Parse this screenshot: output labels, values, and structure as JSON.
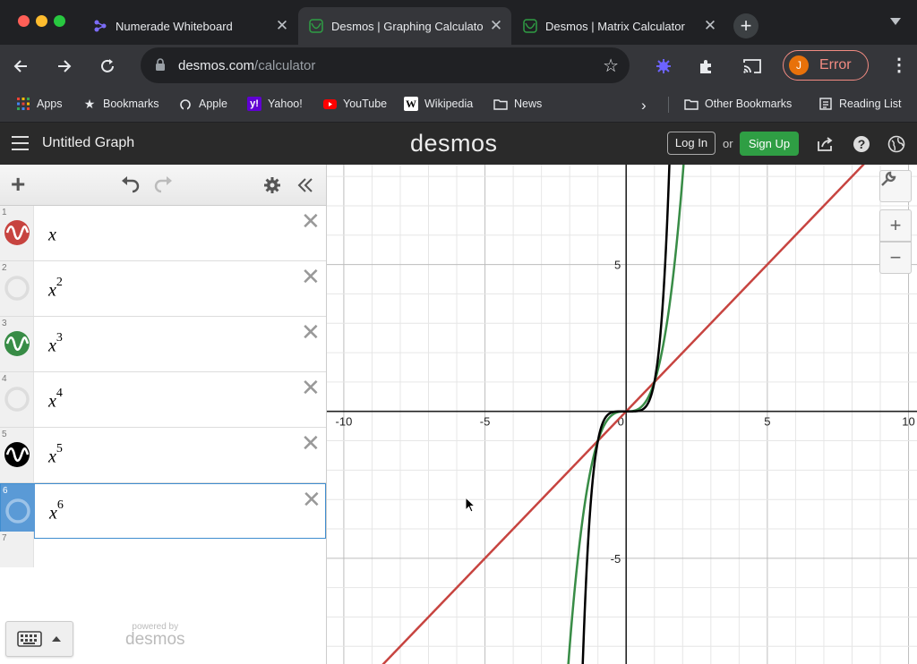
{
  "browser": {
    "tabs": [
      {
        "title": "Numerade Whiteboard",
        "favicon": "numerade-icon"
      },
      {
        "title": "Desmos | Graphing Calculato",
        "favicon": "desmos-icon",
        "active": true
      },
      {
        "title": "Desmos | Matrix Calculator",
        "favicon": "desmos-icon"
      }
    ],
    "close_glyph": "✕",
    "new_tab_glyph": "+",
    "url_domain": "desmos.com",
    "url_path": "/calculator",
    "profile_initial": "J",
    "profile_status": "Error",
    "bookmarks": [
      {
        "label": "Apps",
        "icon": "apps-grid-icon"
      },
      {
        "label": "Bookmarks",
        "icon": "star-icon"
      },
      {
        "label": "Apple",
        "icon": "apple-icon"
      },
      {
        "label": "Yahoo!",
        "icon": "yahoo-icon"
      },
      {
        "label": "YouTube",
        "icon": "youtube-icon"
      },
      {
        "label": "Wikipedia",
        "icon": "wikipedia-icon"
      },
      {
        "label": "News",
        "icon": "folder-icon"
      }
    ],
    "other_bookmarks": "Other Bookmarks",
    "reading_list": "Reading List",
    "colors": {
      "tab_strip": "#202124",
      "toolbar": "#35363a",
      "error": "#f28b82"
    }
  },
  "desmos": {
    "graph_title": "Untitled Graph",
    "logo": "desmos",
    "login_label": "Log In",
    "or_label": "or",
    "signup_label": "Sign Up",
    "expressions": [
      {
        "num": "1",
        "base": "x",
        "exp": "",
        "color": "#c74440",
        "visible": true
      },
      {
        "num": "2",
        "base": "x",
        "exp": "2",
        "color": "#2d70b3",
        "visible": false
      },
      {
        "num": "3",
        "base": "x",
        "exp": "3",
        "color": "#388c46",
        "visible": true
      },
      {
        "num": "4",
        "base": "x",
        "exp": "4",
        "color": "#6042a6",
        "visible": false
      },
      {
        "num": "5",
        "base": "x",
        "exp": "5",
        "color": "#000000",
        "visible": true
      },
      {
        "num": "6",
        "base": "x",
        "exp": "6",
        "color": "#2d70b3",
        "visible": false
      }
    ],
    "selected_expression": "6",
    "empty_row_num": "7",
    "delete_glyph": "✕",
    "powered_by": "powered by",
    "powered_logo": "desmos",
    "zoom_in": "+",
    "zoom_out": "−"
  },
  "graph": {
    "x_range": [
      -10.6,
      10.3
    ],
    "y_range": [
      -8.6,
      8.4
    ],
    "x_ticks": [
      "-10",
      "-5",
      "0",
      "5",
      "10"
    ],
    "y_ticks": [
      "5",
      "-5"
    ],
    "curves": [
      {
        "expr": "x",
        "power": 1,
        "color": "#c74440"
      },
      {
        "expr": "x^3",
        "power": 3,
        "color": "#388c46"
      },
      {
        "expr": "x^5",
        "power": 5,
        "color": "#000000"
      }
    ]
  }
}
